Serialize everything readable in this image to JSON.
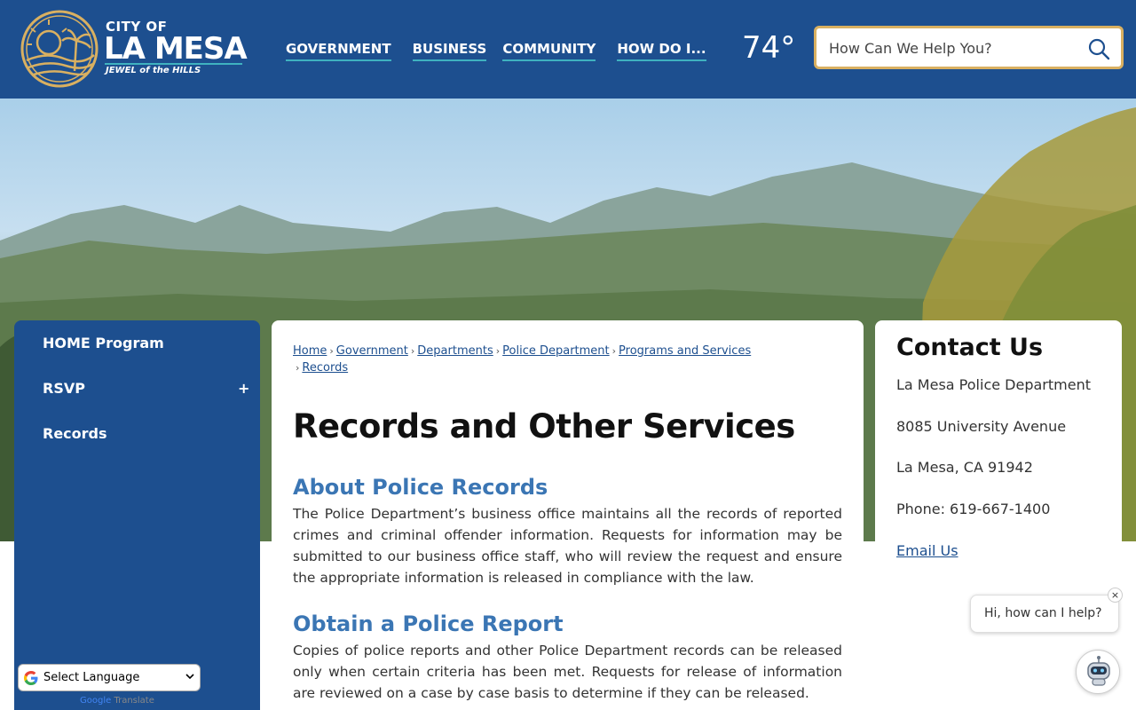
{
  "header": {
    "logo": {
      "small": "CITY OF",
      "big": "LA MESA",
      "tagline": "JEWEL of the HILLS"
    },
    "nav": [
      "GOVERNMENT",
      "BUSINESS",
      "COMMUNITY",
      "HOW DO I..."
    ],
    "weather": "74°",
    "search": {
      "placeholder": "How Can We Help You?"
    }
  },
  "sidebar": {
    "items": [
      "HOME Program",
      "RSVP",
      "Records"
    ],
    "expand_symbol": "+"
  },
  "language": {
    "selected": "Select Language",
    "powered_by": [
      "Google",
      "Translate"
    ]
  },
  "main": {
    "breadcrumbs": [
      "Home",
      "Government",
      "Departments",
      "Police Department",
      "Programs and Services",
      "Records"
    ],
    "title": "Records and Other Services",
    "sections": [
      {
        "heading": "About Police Records",
        "text": "The Police Department’s business office maintains all the records of reported crimes and criminal offender information. Requests for information may be submitted to our business office staff, who will review the request and ensure the appropriate information is released in compliance with the law."
      },
      {
        "heading": "Obtain a Police Report",
        "text": "Copies of police reports and other Police Department records can be released only when certain criteria has been met. Requests for release of information are reviewed on a case by case basis to determine if they can be released."
      }
    ]
  },
  "contact": {
    "title": "Contact Us",
    "lines": [
      "La Mesa Police Department",
      "8085 University Avenue",
      "La Mesa, CA 91942",
      "Phone: 619-667-1400"
    ],
    "email_label": "Email Us"
  },
  "chat": {
    "greeting": "Hi, how can I help?",
    "close": "×"
  },
  "colors": {
    "brand": "#1d4f8f",
    "accent": "#3fb2c0",
    "gold": "#d9b061",
    "heading": "#3b76b4"
  }
}
